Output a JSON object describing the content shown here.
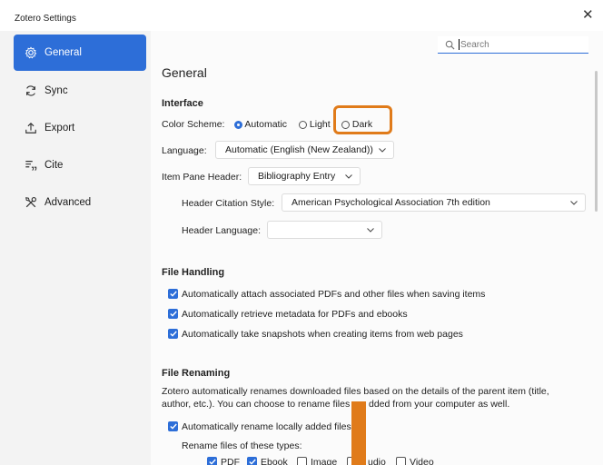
{
  "window": {
    "title": "Zotero Settings",
    "close_glyph": "✕"
  },
  "sidebar": {
    "items": [
      {
        "label": "General",
        "icon": "gear-icon",
        "active": true
      },
      {
        "label": "Sync",
        "icon": "sync-icon"
      },
      {
        "label": "Export",
        "icon": "export-icon"
      },
      {
        "label": "Cite",
        "icon": "cite-icon"
      },
      {
        "label": "Advanced",
        "icon": "advanced-icon"
      }
    ]
  },
  "search": {
    "placeholder": "Search"
  },
  "general": {
    "title": "General",
    "interface": {
      "heading": "Interface",
      "color_scheme_label": "Color Scheme:",
      "options": [
        "Automatic",
        "Light",
        "Dark"
      ],
      "selected": "Automatic",
      "language_label": "Language:",
      "language_value": "Automatic (English (New Zealand))",
      "item_pane_header_label": "Item Pane Header:",
      "item_pane_header_value": "Bibliography Entry",
      "header_citation_style_label": "Header Citation Style:",
      "header_citation_style_value": "American Psychological Association 7th edition",
      "header_language_label": "Header Language:",
      "header_language_value": ""
    },
    "file_handling": {
      "heading": "File Handling",
      "options": [
        {
          "label": "Automatically attach associated PDFs and other files when saving items",
          "checked": true
        },
        {
          "label": "Automatically retrieve metadata for PDFs and ebooks",
          "checked": true
        },
        {
          "label": "Automatically take snapshots when creating items from web pages",
          "checked": true
        }
      ]
    },
    "file_renaming": {
      "heading": "File Renaming",
      "description_line1": "Zotero automatically renames downloaded files based on the details of the parent item (title,",
      "description_line2_a": "author, etc.). You can choose to rename files",
      "description_line2_b": "dded from your computer as well.",
      "auto_rename_label": "Automatically rename locally added files",
      "auto_rename_checked": true,
      "types_label": "Rename files of these types:",
      "types": [
        {
          "label": "PDF",
          "checked": true
        },
        {
          "label": "Ebook",
          "checked": true
        },
        {
          "label": "Image",
          "checked": false
        },
        {
          "label": "udio",
          "checked": false
        },
        {
          "label": "Video",
          "checked": false
        }
      ]
    }
  },
  "colors": {
    "accent": "#2d6ed8",
    "highlight": "#e07b1a"
  }
}
